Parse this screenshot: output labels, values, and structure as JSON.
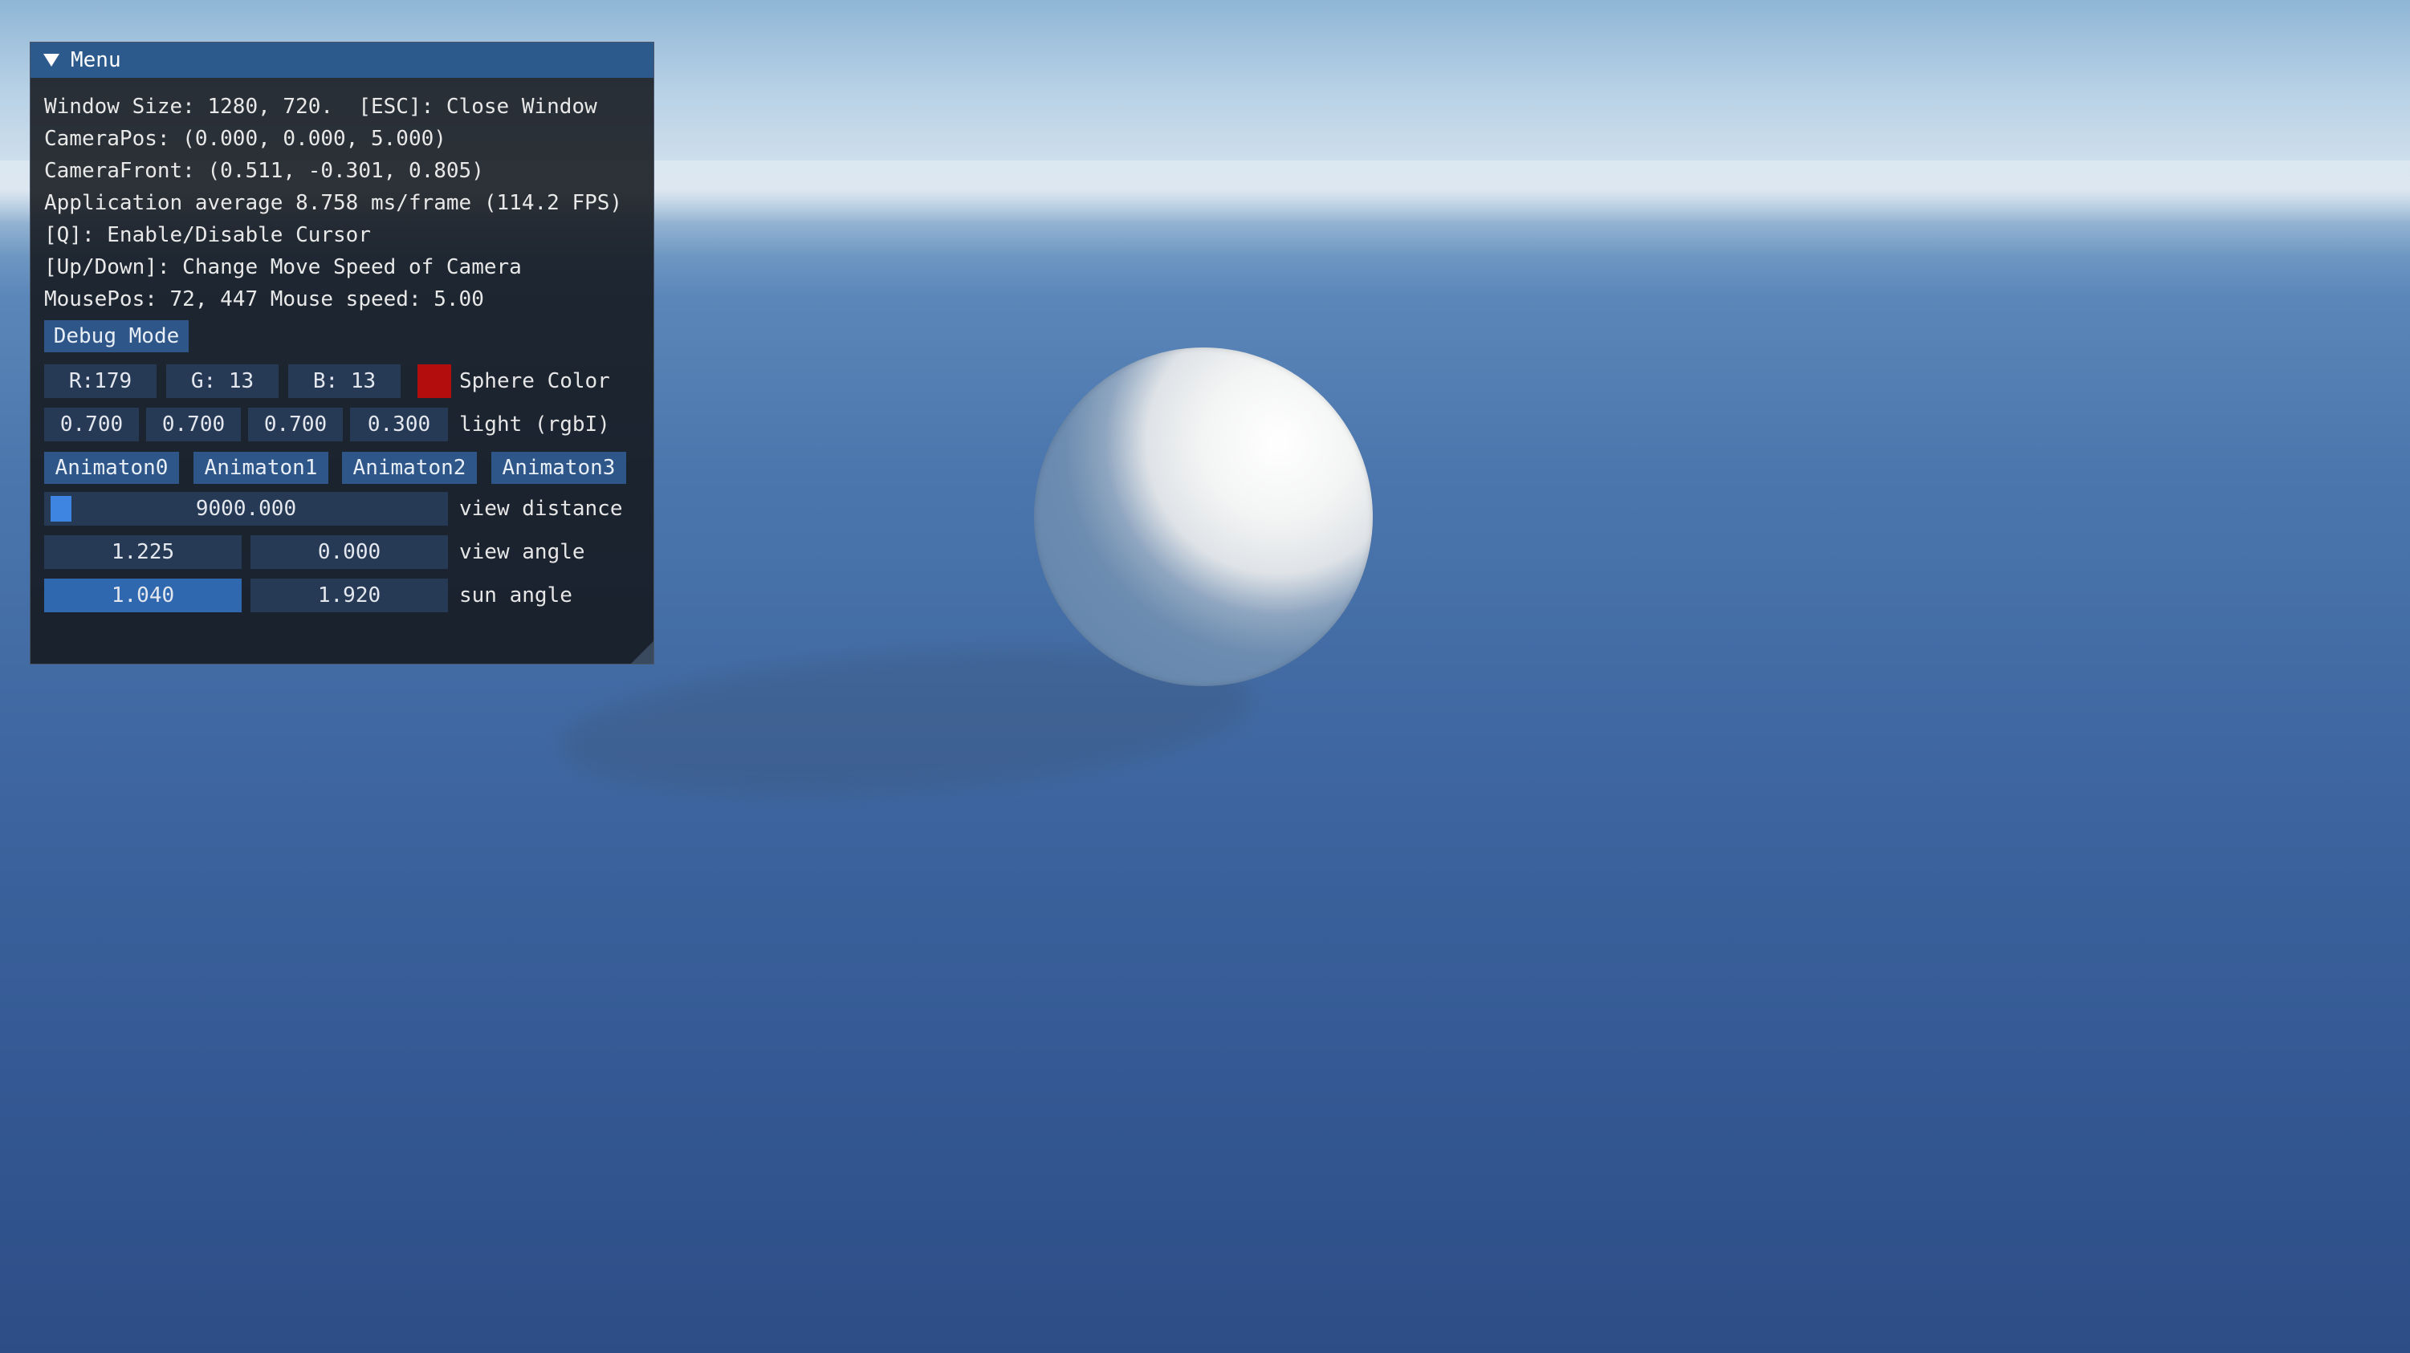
{
  "menu": {
    "title": "Menu",
    "info_lines": [
      "Window Size: 1280, 720.  [ESC]: Close Window",
      "CameraPos: (0.000, 0.000, 5.000)",
      "CameraFront: (0.511, -0.301, 0.805)",
      "Application average 8.758 ms/frame (114.2 FPS)",
      "[Q]: Enable/Disable Cursor",
      "[Up/Down]: Change Move Speed of Camera",
      "MousePos: 72, 447 Mouse speed: 5.00"
    ],
    "debug_mode_label": "Debug Mode",
    "sphere_color": {
      "r_label": "R:179",
      "g_label": "G: 13",
      "b_label": "B: 13",
      "swatch_color": "#b30d0d",
      "label": "Sphere Color"
    },
    "light": {
      "values": [
        "0.700",
        "0.700",
        "0.700",
        "0.300"
      ],
      "label": "light (rgbI)"
    },
    "animations": [
      "Animaton0",
      "Animaton1",
      "Animaton2",
      "Animaton3"
    ],
    "view_distance": {
      "value": "9000.000",
      "label": "view distance"
    },
    "view_angle": {
      "values": [
        "1.225",
        "0.000"
      ],
      "label": "view angle"
    },
    "sun_angle": {
      "values": [
        "1.040",
        "1.920"
      ],
      "label": "sun angle"
    }
  },
  "colors": {
    "title_bar": "#2c5a8c",
    "button": "#2e5688",
    "field": "#263a56",
    "active_field": "#3068b0"
  }
}
